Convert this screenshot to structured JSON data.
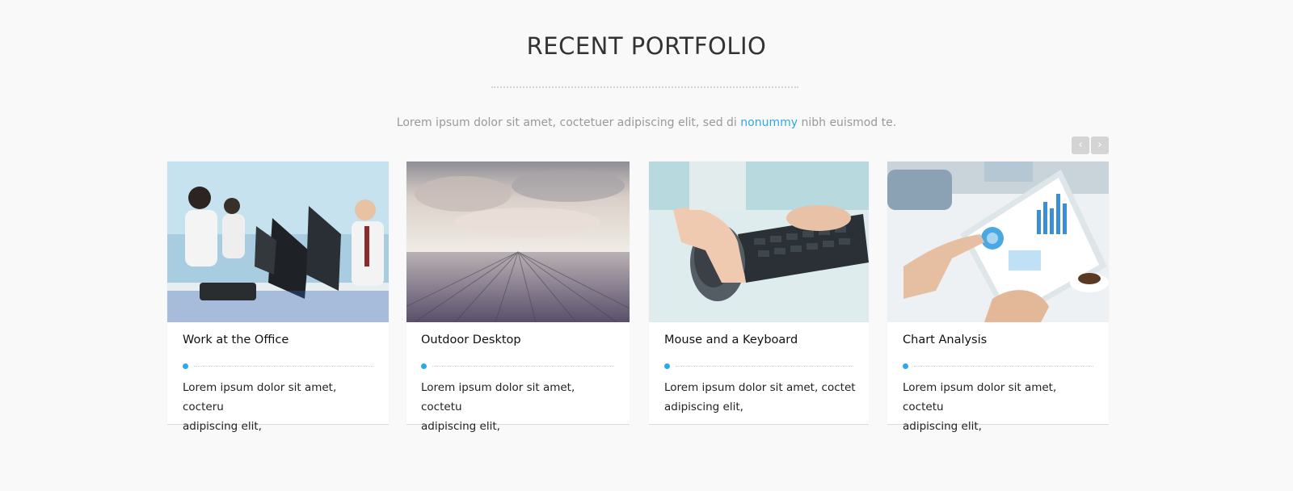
{
  "section": {
    "title": "RECENT PORTFOLIO",
    "intro_before": "Lorem ipsum dolor sit amet, coctetuer adipiscing elit, sed di ",
    "intro_accent": "nonummy",
    "intro_after": " nibh euismod te."
  },
  "carousel": {
    "prev_label": "‹",
    "next_label": "›"
  },
  "colors": {
    "accent": "#2fa8e8",
    "background": "#f9f9f9",
    "nav_button": "#d4d4d4"
  },
  "cards": [
    {
      "title": "Work at the Office",
      "description": "Lorem ipsum dolor sit amet, cocteru\nadipiscing elit,"
    },
    {
      "title": "Outdoor Desktop",
      "description": "Lorem ipsum dolor sit amet, coctetu\nadipiscing elit,"
    },
    {
      "title": "Mouse and a Keyboard",
      "description": "Lorem ipsum dolor sit amet, coctet\nadipiscing elit,"
    },
    {
      "title": "Chart Analysis",
      "description": "Lorem ipsum dolor sit amet, coctetu\nadipiscing elit,"
    }
  ]
}
